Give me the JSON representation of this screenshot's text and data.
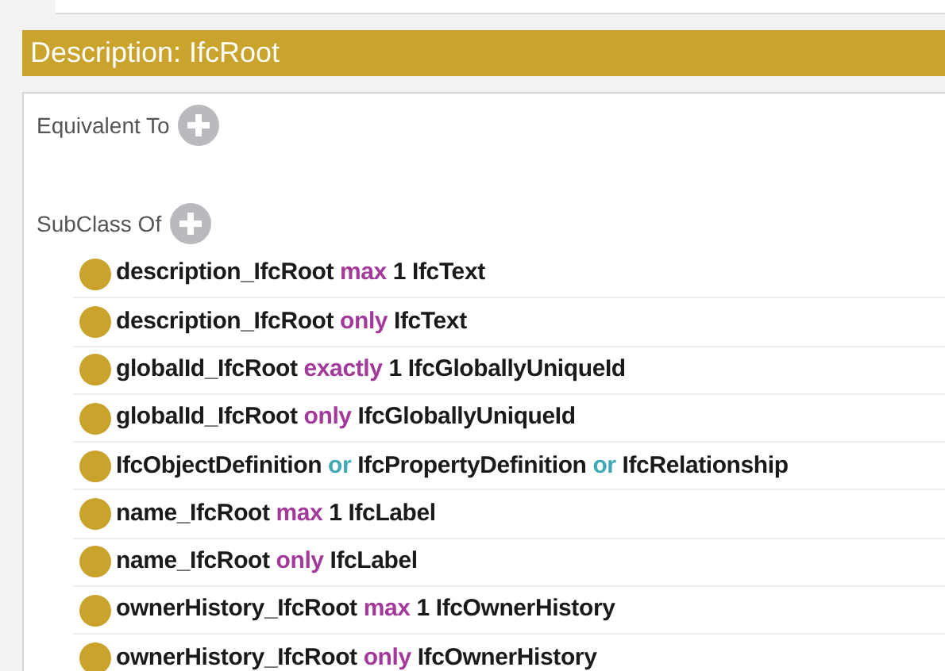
{
  "header": {
    "title": "Description: IfcRoot"
  },
  "sections": [
    {
      "label": "Equivalent To"
    },
    {
      "label": "SubClass Of",
      "items": [
        {
          "tokens": [
            {
              "kind": "name",
              "text": "description_IfcRoot"
            },
            {
              "kind": "keyword",
              "text": "max"
            },
            {
              "kind": "name",
              "text": "1"
            },
            {
              "kind": "name",
              "text": "IfcText"
            }
          ]
        },
        {
          "tokens": [
            {
              "kind": "name",
              "text": "description_IfcRoot"
            },
            {
              "kind": "keyword",
              "text": "only"
            },
            {
              "kind": "name",
              "text": "IfcText"
            }
          ]
        },
        {
          "tokens": [
            {
              "kind": "name",
              "text": "globalId_IfcRoot"
            },
            {
              "kind": "keyword",
              "text": "exactly"
            },
            {
              "kind": "name",
              "text": "1"
            },
            {
              "kind": "name",
              "text": "IfcGloballyUniqueId"
            }
          ]
        },
        {
          "tokens": [
            {
              "kind": "name",
              "text": "globalId_IfcRoot"
            },
            {
              "kind": "keyword",
              "text": "only"
            },
            {
              "kind": "name",
              "text": "IfcGloballyUniqueId"
            }
          ]
        },
        {
          "tokens": [
            {
              "kind": "name",
              "text": "IfcObjectDefinition"
            },
            {
              "kind": "connective",
              "text": "or"
            },
            {
              "kind": "name",
              "text": "IfcPropertyDefinition"
            },
            {
              "kind": "connective",
              "text": "or"
            },
            {
              "kind": "name",
              "text": "IfcRelationship"
            }
          ]
        },
        {
          "tokens": [
            {
              "kind": "name",
              "text": "name_IfcRoot"
            },
            {
              "kind": "keyword",
              "text": "max"
            },
            {
              "kind": "name",
              "text": "1"
            },
            {
              "kind": "name",
              "text": "IfcLabel"
            }
          ]
        },
        {
          "tokens": [
            {
              "kind": "name",
              "text": "name_IfcRoot"
            },
            {
              "kind": "keyword",
              "text": "only"
            },
            {
              "kind": "name",
              "text": "IfcLabel"
            }
          ]
        },
        {
          "tokens": [
            {
              "kind": "name",
              "text": "ownerHistory_IfcRoot"
            },
            {
              "kind": "keyword",
              "text": "max"
            },
            {
              "kind": "name",
              "text": "1"
            },
            {
              "kind": "name",
              "text": "IfcOwnerHistory"
            }
          ]
        },
        {
          "tokens": [
            {
              "kind": "name",
              "text": "ownerHistory_IfcRoot"
            },
            {
              "kind": "keyword",
              "text": "only"
            },
            {
              "kind": "name",
              "text": "IfcOwnerHistory"
            }
          ]
        }
      ]
    }
  ]
}
